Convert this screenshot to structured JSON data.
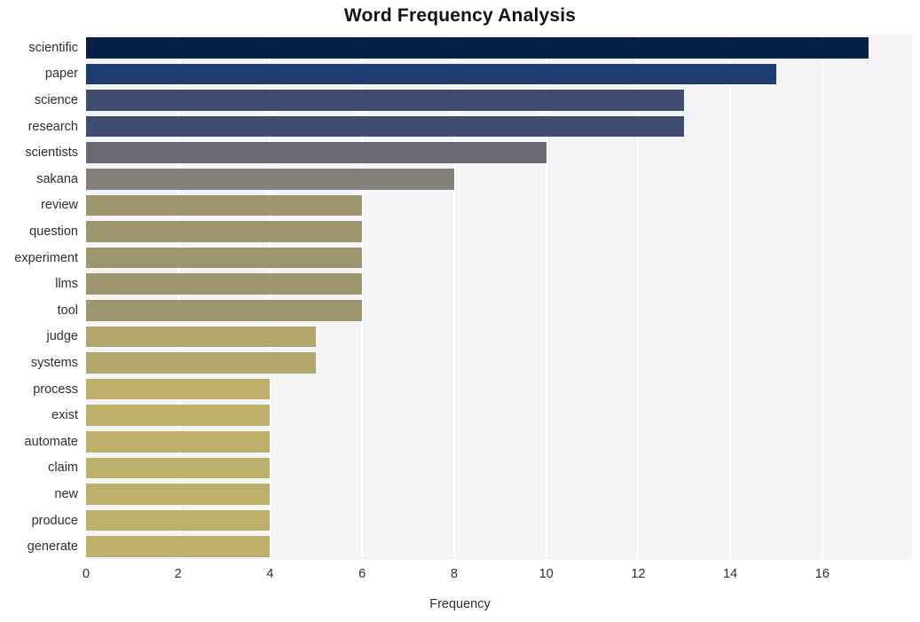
{
  "chart_data": {
    "type": "bar",
    "orientation": "horizontal",
    "title": "Word Frequency Analysis",
    "xlabel": "Frequency",
    "ylabel": "",
    "categories": [
      "scientific",
      "paper",
      "science",
      "research",
      "scientists",
      "sakana",
      "review",
      "question",
      "experiment",
      "llms",
      "tool",
      "judge",
      "systems",
      "process",
      "exist",
      "automate",
      "claim",
      "new",
      "produce",
      "generate"
    ],
    "values": [
      17,
      15,
      13,
      13,
      10,
      8,
      6,
      6,
      6,
      6,
      6,
      5,
      5,
      4,
      4,
      4,
      4,
      4,
      4,
      4
    ],
    "bar_colors": [
      "#052246",
      "#1c3c70",
      "#414d70",
      "#414d70",
      "#6a6a72",
      "#83817a",
      "#9d956e",
      "#9d956e",
      "#9d956e",
      "#9d956e",
      "#9d956e",
      "#b2a76b",
      "#b2a76b",
      "#bdb06a",
      "#bdb06a",
      "#bdb06a",
      "#bdb06a",
      "#bdb06a",
      "#bdb06a",
      "#bdb06a"
    ],
    "xticks": [
      0,
      2,
      4,
      6,
      8,
      10,
      12,
      14,
      16
    ],
    "xtick_labels": [
      "0",
      "2",
      "4",
      "6",
      "8",
      "10",
      "12",
      "14",
      "16"
    ],
    "xlim": [
      0,
      17.95
    ],
    "grid": "vertical",
    "grid_color": "#ffffff",
    "plot_background": "#f4f4f6",
    "figure_background": "#ffffff",
    "legend": null
  }
}
